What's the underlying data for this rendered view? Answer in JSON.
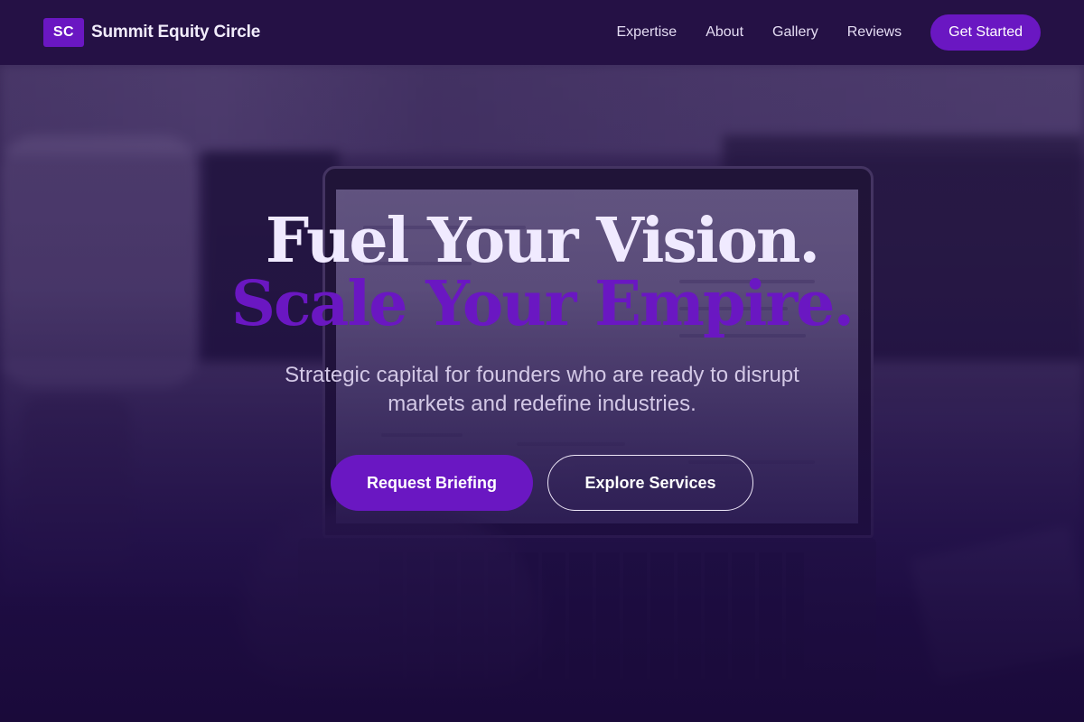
{
  "nav": {
    "logo_mark": "SC",
    "brand_name": "Summit Equity Circle",
    "links": [
      "Expertise",
      "About",
      "Gallery",
      "Reviews"
    ],
    "cta_label": "Get Started"
  },
  "hero": {
    "headline_line1": "Fuel Your Vision.",
    "headline_line2": "Scale Your Empire.",
    "subheadline": "Strategic capital for founders who are ready to disrupt markets and redefine industries.",
    "primary_button": "Request Briefing",
    "secondary_button": "Explore Services"
  },
  "colors": {
    "accent": "#6a17c2",
    "nav_background": "#251145",
    "page_background": "#1a0b33"
  }
}
